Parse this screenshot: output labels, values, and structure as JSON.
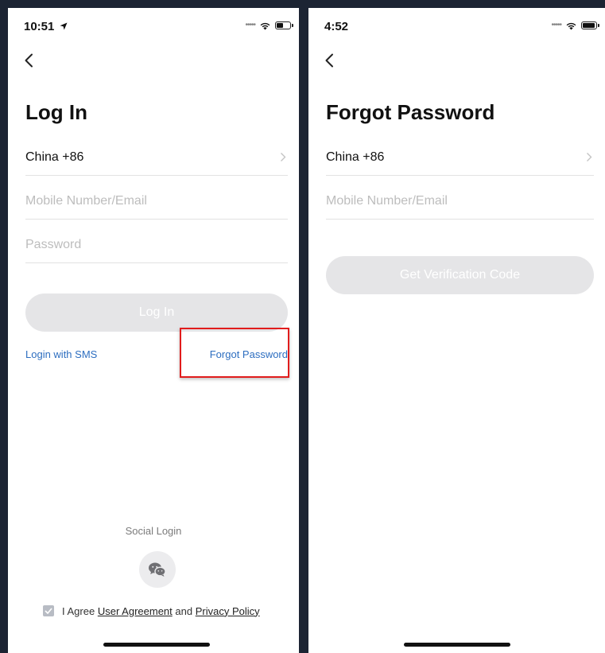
{
  "left_screen": {
    "status_time": "10:51",
    "title": "Log In",
    "country": "China +86",
    "account_placeholder": "Mobile Number/Email",
    "password_placeholder": "Password",
    "login_button": "Log In",
    "sms_link": "Login with SMS",
    "forgot_link": "Forgot Password",
    "social_label": "Social Login",
    "agree_prefix": "I Agree",
    "user_agreement": "User Agreement",
    "agree_and": "and",
    "privacy_policy": "Privacy Policy",
    "agree_checked": true,
    "highlight_color": "#e11c1c"
  },
  "right_screen": {
    "status_time": "4:52",
    "title": "Forgot Password",
    "country": "China +86",
    "account_placeholder": "Mobile Number/Email",
    "verify_button": "Get Verification Code"
  },
  "icons": {
    "back": "chevron-left-icon",
    "country_arrow": "chevron-right-icon",
    "social": "wechat-icon",
    "location": "location-arrow-icon",
    "wifi": "wifi-icon",
    "battery": "battery-icon",
    "signal": "signal-dots-icon"
  },
  "colors": {
    "link": "#2d6ec0",
    "button_disabled": "#e5e5e7",
    "background": "#1c2433"
  }
}
